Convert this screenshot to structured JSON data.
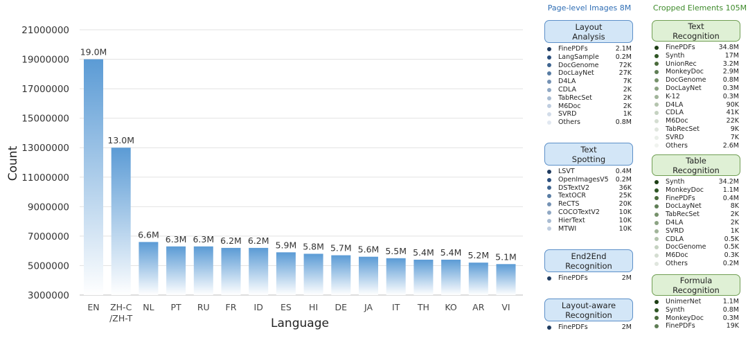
{
  "chart_data": {
    "type": "bar",
    "xlabel": "Language",
    "ylabel": "Count",
    "categories": [
      "EN",
      "ZH-C\n/ZH-T",
      "NL",
      "PT",
      "RU",
      "FR",
      "ID",
      "ES",
      "HI",
      "DE",
      "JA",
      "IT",
      "TH",
      "KO",
      "AR",
      "VI"
    ],
    "values": [
      19000000,
      13000000,
      6600000,
      6300000,
      6300000,
      6200000,
      6200000,
      5900000,
      5800000,
      5700000,
      5600000,
      5500000,
      5400000,
      5400000,
      5200000,
      5100000
    ],
    "data_labels": [
      "19.0M",
      "13.0M",
      "6.6M",
      "6.3M",
      "6.3M",
      "6.2M",
      "6.2M",
      "5.9M",
      "5.8M",
      "5.7M",
      "5.6M",
      "5.5M",
      "5.4M",
      "5.4M",
      "5.2M",
      "5.1M"
    ],
    "yticks": [
      3000000,
      5000000,
      7000000,
      9000000,
      11000000,
      13000000,
      15000000,
      17000000,
      19000000,
      21000000
    ],
    "ylim": [
      3000000,
      21000000
    ],
    "grid": true,
    "bar_color_top": "#5b9bd5",
    "bar_color_bottom": "#ffffff"
  },
  "page_level": {
    "title": "Page-level Images 8M",
    "groups": [
      {
        "label": "Layout\nAnalysis",
        "items": [
          [
            "FinePDFs",
            "2.1M"
          ],
          [
            "LangSample",
            "0.2M"
          ],
          [
            "DocGenome",
            "72K"
          ],
          [
            "DocLayNet",
            "27K"
          ],
          [
            "D4LA",
            "7K"
          ],
          [
            "CDLA",
            "2K"
          ],
          [
            "TabRecSet",
            "2K"
          ],
          [
            "M6Doc",
            "2K"
          ],
          [
            "SVRD",
            "1K"
          ],
          [
            "Others",
            "0.8M"
          ]
        ]
      },
      {
        "label": "Text\nSpotting",
        "items": [
          [
            "LSVT",
            "0.4M"
          ],
          [
            "OpenImagesV5",
            "0.2M"
          ],
          [
            "DSTextV2",
            "36K"
          ],
          [
            "TextOCR",
            "25K"
          ],
          [
            "ReCTS",
            "20K"
          ],
          [
            "COCOTextV2",
            "10K"
          ],
          [
            "HierText",
            "10K"
          ],
          [
            "MTWI",
            "10K"
          ]
        ]
      },
      {
        "label": "End2End\nRecognition",
        "items": [
          [
            "FinePDFs",
            "2M"
          ]
        ]
      },
      {
        "label": "Layout-aware\nRecognition",
        "items": [
          [
            "FinePDFs",
            "2M"
          ]
        ]
      }
    ]
  },
  "cropped": {
    "title": "Cropped Elements 105M",
    "groups": [
      {
        "label": "Text\nRecognition",
        "items": [
          [
            "FinePDFs",
            "34.8M"
          ],
          [
            "Synth",
            "17M"
          ],
          [
            "UnionRec",
            "3.2M"
          ],
          [
            "MonkeyDoc",
            "2.9M"
          ],
          [
            "DocGenome",
            "0.8M"
          ],
          [
            "DocLayNet",
            "0.3M"
          ],
          [
            "K-12",
            "0.3M"
          ],
          [
            "D4LA",
            "90K"
          ],
          [
            "CDLA",
            "41K"
          ],
          [
            "M6Doc",
            "22K"
          ],
          [
            "TabRecSet",
            "9K"
          ],
          [
            "SVRD",
            "7K"
          ],
          [
            "Others",
            "2.6M"
          ]
        ]
      },
      {
        "label": "Table\nRecognition",
        "items": [
          [
            "Synth",
            "34.2M"
          ],
          [
            "MonkeyDoc",
            "1.1M"
          ],
          [
            "FinePDFs",
            "0.4M"
          ],
          [
            "DocLayNet",
            "8K"
          ],
          [
            "TabRecSet",
            "2K"
          ],
          [
            "D4LA",
            "2K"
          ],
          [
            "SVRD",
            "1K"
          ],
          [
            "CDLA",
            "0.5K"
          ],
          [
            "DocGenome",
            "0.5K"
          ],
          [
            "M6Doc",
            "0.3K"
          ],
          [
            "Others",
            "0.2M"
          ]
        ]
      },
      {
        "label": "Formula\nRecognition",
        "items": [
          [
            "UnimerNet",
            "1.1M"
          ],
          [
            "Synth",
            "0.8M"
          ],
          [
            "MonkeyDoc",
            "0.3M"
          ],
          [
            "FinePDFs",
            "19K"
          ]
        ]
      }
    ]
  },
  "colors": {
    "blue_dots": [
      "#1f3b60",
      "#2b4f7d",
      "#3f6590",
      "#587ca3",
      "#7592b4",
      "#90a8c4",
      "#a9bcd2",
      "#bfcddf",
      "#d3dde9",
      "#e1e8f1"
    ],
    "green_dots": [
      "#1d3d14",
      "#2e5524",
      "#4a6b3c",
      "#5f7d55",
      "#76916b",
      "#8ca383",
      "#a1b49a",
      "#b4c4ae",
      "#c5d2c1",
      "#d4ddd1",
      "#e0e6de",
      "#e9eee8",
      "#f0f3ef"
    ]
  }
}
